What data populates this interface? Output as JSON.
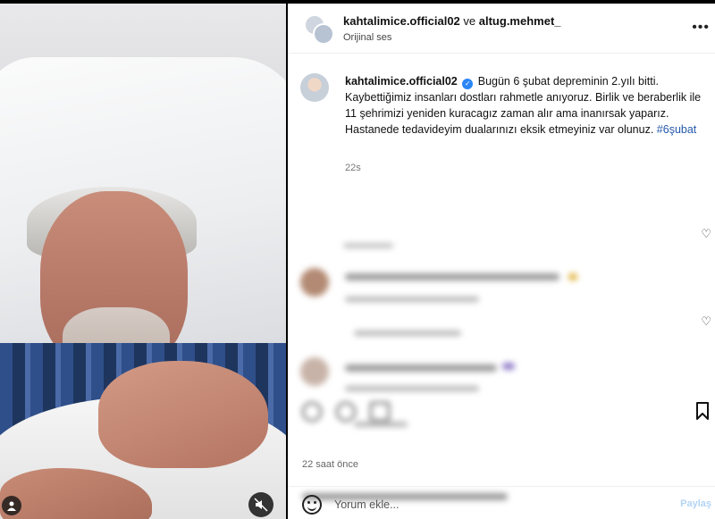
{
  "post": {
    "header": {
      "user1": "kahtalimice.official02",
      "joiner": "ve",
      "user2": "altug.mehmet_",
      "audio": "Orijinal ses",
      "more_icon": "more-horizontal-icon"
    },
    "caption": {
      "username": "kahtalimice.official02",
      "verified_icon": "verified-badge-icon",
      "text": "Bugün 6 şubat depreminin 2.yılı bitti. Kaybettiğimiz insanları dostları rahmetle anıyoruz. Birlik ve beraberlik ile 11 şehrimizi yeniden kuracagız zaman alır ama inanırsak yaparız. Hastanede tedavideyim dualarınızı eksik etmeyiniz var olunuz.",
      "hashtag": "#6şubat",
      "time": "22s"
    },
    "footer": {
      "time_ago": "22 saat önce",
      "comment_placeholder": "Yorum ekle...",
      "post_button": "Paylaş"
    },
    "media": {
      "mute_icon": "muted-speaker-icon",
      "tag_icon": "user-tag-icon"
    },
    "colors": {
      "verified": "#2b86f5",
      "hashtag": "#2458a8",
      "post_button": "#b3d4f5"
    }
  }
}
